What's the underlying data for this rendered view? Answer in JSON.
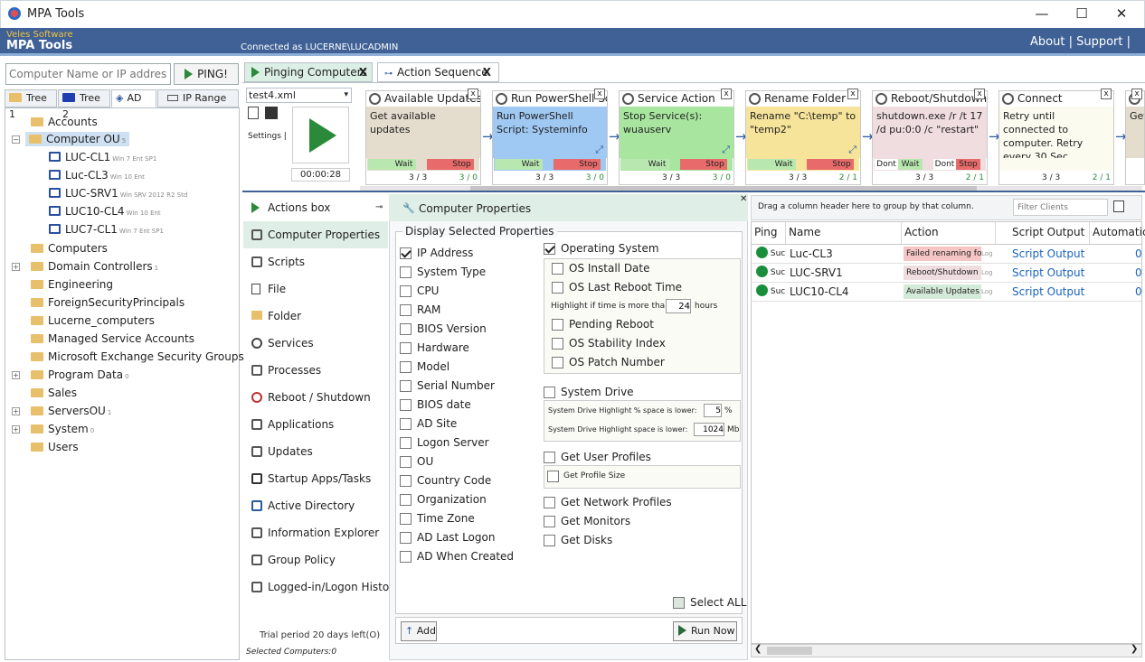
{
  "window": {
    "title": "MPA Tools",
    "minimize": "—",
    "maximize": "☐",
    "close": "✕"
  },
  "banner": {
    "vendor": "Veles Software",
    "app_name": "MPA Tools",
    "connected": "Connected as LUCERNE\\LUCADMIN",
    "links": "About | Support |"
  },
  "search": {
    "placeholder": "Computer Name or IP address",
    "ping_label": "PING!"
  },
  "left_tabs": [
    {
      "label": "Tree 1"
    },
    {
      "label": "Tree 2"
    },
    {
      "label": "AD"
    },
    {
      "label": "IP Range"
    }
  ],
  "tree": [
    {
      "label": "Accounts",
      "note": ""
    },
    {
      "label": "Computer OU",
      "note": "5"
    },
    {
      "label": "LUC-CL1",
      "note": "Win 7 Ent SP1"
    },
    {
      "label": "Luc-CL3",
      "note": "Win 10 Ent"
    },
    {
      "label": "LUC-SRV1",
      "note": "Win SRV 2012 R2 Std"
    },
    {
      "label": "LUC10-CL4",
      "note": "Win 10 Ent"
    },
    {
      "label": "LUC7-CL1",
      "note": "Win 7 Ent SP1"
    },
    {
      "label": "Computers",
      "note": ""
    },
    {
      "label": "Domain Controllers",
      "note": "1"
    },
    {
      "label": "Engineering",
      "note": ""
    },
    {
      "label": "ForeignSecurityPrincipals",
      "note": ""
    },
    {
      "label": "Lucerne_computers",
      "note": ""
    },
    {
      "label": "Managed Service Accounts",
      "note": ""
    },
    {
      "label": "Microsoft Exchange Security Groups",
      "note": ""
    },
    {
      "label": "Program Data",
      "note": "0"
    },
    {
      "label": "Sales",
      "note": ""
    },
    {
      "label": "ServersOU",
      "note": "1"
    },
    {
      "label": "System",
      "note": "0"
    },
    {
      "label": "Users",
      "note": ""
    }
  ],
  "seq_tabs": [
    {
      "label": "Pinging Computers",
      "close": "X"
    },
    {
      "label": "Action Sequence",
      "close": "X"
    }
  ],
  "sequence": {
    "file": "test4.xml",
    "settings": "Settings |",
    "timer": "00:00:28"
  },
  "cards": [
    {
      "title": "Available Updates",
      "body": "Get available updates",
      "color": "#e4dccd",
      "left": "",
      "mid": "Wait",
      "right": "Stop",
      "count": "3 / 3",
      "count2": "3 / 0",
      "close": "x"
    },
    {
      "title": "Run PowerShell Script",
      "body": "Run PowerShell Script: Systeminfo",
      "color": "#9fc8f2",
      "left": "",
      "mid": "Wait",
      "right": "Stop",
      "count": "3 / 3",
      "count2": "3 / 0",
      "close": "x"
    },
    {
      "title": "Service Action",
      "body": "Stop Service(s): wuauserv",
      "color": "#a8e6a0",
      "left": "",
      "mid": "Wait",
      "right": "Stop",
      "count": "3 / 3",
      "count2": "3 / 0",
      "close": "x"
    },
    {
      "title": "Rename Folder",
      "body": "Rename \"C:\\temp\" to \"temp2\"",
      "color": "#f6e49a",
      "left": "",
      "mid": "Wait",
      "right": "Stop",
      "count": "3 / 3",
      "count2": "2 / 1",
      "close": "x"
    },
    {
      "title": "Reboot/Shutdown",
      "body": "shutdown.exe  /r /t 17 /d pu:0:0 /c \"restart\"",
      "color": "#f0dde0",
      "left": "Dont",
      "mid": "Wait",
      "right": "Stop",
      "left2": "Dont",
      "count": "3 / 3",
      "count2": "2 / 1",
      "close": "x"
    },
    {
      "title": "Connect",
      "body": "Retry until connected to computer. Retry every 30 Sec",
      "color": "#fbfbf0",
      "left": "",
      "mid": "",
      "right": "",
      "count": "3 / 3",
      "count2": "2 / 1",
      "close": "x"
    },
    {
      "title": "A",
      "body": "Get",
      "color": "#e4dccd",
      "left": "",
      "mid": "",
      "right": "",
      "count": "",
      "count2": "",
      "close": "x"
    }
  ],
  "nav": [
    {
      "label": "Actions box"
    },
    {
      "label": "Computer Properties"
    },
    {
      "label": "Scripts"
    },
    {
      "label": "File"
    },
    {
      "label": "Folder"
    },
    {
      "label": "Services"
    },
    {
      "label": "Processes"
    },
    {
      "label": "Reboot / Shutdown"
    },
    {
      "label": "Applications"
    },
    {
      "label": "Updates"
    },
    {
      "label": "Startup Apps/Tasks"
    },
    {
      "label": "Active Directory"
    },
    {
      "label": "Information Explorer"
    },
    {
      "label": "Group Policy"
    },
    {
      "label": "Logged-in/Logon History"
    }
  ],
  "trial": "Trial period 20 days left(O)",
  "selected": "Selected Computers:0",
  "props": {
    "header": "Computer Properties",
    "group_title": "Display Selected Properties",
    "left": [
      {
        "label": "IP Address",
        "checked": true
      },
      {
        "label": "System Type",
        "checked": false
      },
      {
        "label": "CPU",
        "checked": false
      },
      {
        "label": "RAM",
        "checked": false
      },
      {
        "label": "BIOS Version",
        "checked": false
      },
      {
        "label": "Hardware",
        "checked": false
      },
      {
        "label": "Model",
        "checked": false
      },
      {
        "label": "Serial Number",
        "checked": false
      },
      {
        "label": "BIOS date",
        "checked": false
      },
      {
        "label": "AD Site",
        "checked": false
      },
      {
        "label": "Logon Server",
        "checked": false
      },
      {
        "label": "OU",
        "checked": false
      },
      {
        "label": "Country Code",
        "checked": false
      },
      {
        "label": "Organization",
        "checked": false
      },
      {
        "label": "Time Zone",
        "checked": false
      },
      {
        "label": "AD Last Logon",
        "checked": false
      },
      {
        "label": "AD When Created",
        "checked": false
      }
    ],
    "os": {
      "label": "Operating System",
      "checked": true,
      "install": "OS Install Date",
      "reboot": "OS Last Reboot Time",
      "highlight": "Highlight if time is more than:",
      "hours_val": "24",
      "hours": "hours",
      "pending": "Pending Reboot",
      "stability": "OS Stability Index",
      "patch": "OS Patch Number"
    },
    "sysdrive": {
      "label": "System Drive",
      "pct_label": "System Drive Highlight % space is lower:",
      "pct_val": "5",
      "pct_unit": "%",
      "mb_label": "System Drive Highlight space is lower:",
      "mb_val": "1024",
      "mb_unit": "Mb"
    },
    "profiles": "Get User Profiles",
    "profile_size": "Get Profile Size",
    "network": "Get Network Profiles",
    "monitors": "Get Monitors",
    "disks": "Get Disks",
    "select_all": "Select ALL",
    "add": "Add",
    "run_now": "Run Now"
  },
  "grid": {
    "drag_hint": "Drag a column header here to group by that column.",
    "filter_placeholder": "Filter Clients",
    "columns": [
      "Ping",
      "Name",
      "Action",
      "Script Output",
      "Automatic"
    ],
    "rows": [
      {
        "ping": "Suc",
        "name": "Luc-CL3",
        "action": "Failed renaming fold",
        "log": "Log",
        "output": "Script Output",
        "auto": "0",
        "action_color": "#f6c6c6"
      },
      {
        "ping": "Suc",
        "name": "LUC-SRV1",
        "action": "Reboot/Shutdown",
        "log": "Log",
        "output": "Script Output",
        "auto": "0",
        "action_color": "#f0dde0"
      },
      {
        "ping": "Suc",
        "name": "LUC10-CL4",
        "action": "Available Updates",
        "log": "Log",
        "output": "Script Output",
        "auto": "0",
        "action_color": "#d4ead8"
      }
    ]
  }
}
